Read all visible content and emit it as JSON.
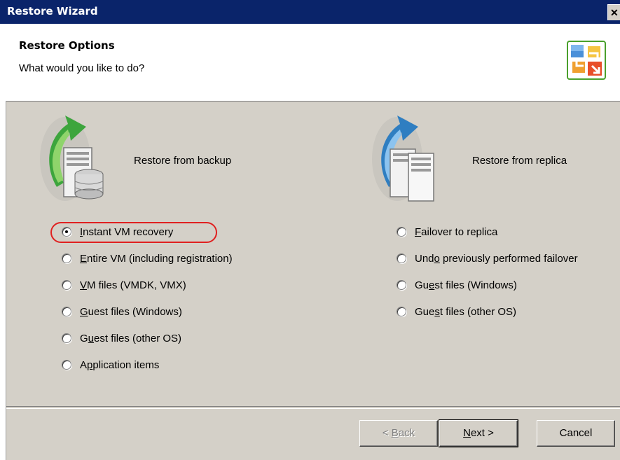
{
  "window": {
    "title": "Restore Wizard",
    "close_glyph": "✕"
  },
  "header": {
    "title": "Restore Options",
    "subtitle": "What would you like to do?",
    "icon": "restore-wizard-icon"
  },
  "backup_group": {
    "label": "Restore from backup",
    "icon": "backup-server-database-icon",
    "options": [
      {
        "pre": "",
        "u": "I",
        "post": "nstant VM recovery",
        "checked": true
      },
      {
        "pre": "",
        "u": "E",
        "post": "ntire VM (including registration)",
        "checked": false
      },
      {
        "pre": "",
        "u": "V",
        "post": "M files (VMDK, VMX)",
        "checked": false
      },
      {
        "pre": "",
        "u": "G",
        "post": "uest files (Windows)",
        "checked": false
      },
      {
        "pre": "G",
        "u": "u",
        "post": "est files (other OS)",
        "checked": false
      },
      {
        "pre": "A",
        "u": "p",
        "post": "plication items",
        "checked": false
      }
    ]
  },
  "replica_group": {
    "label": "Restore from replica",
    "icon": "replica-server-icon",
    "options": [
      {
        "pre": "",
        "u": "F",
        "post": "ailover to replica",
        "checked": false
      },
      {
        "pre": "Und",
        "u": "o",
        "post": " previously performed failover",
        "checked": false
      },
      {
        "pre": "Gu",
        "u": "e",
        "post": "st files (Windows)",
        "checked": false
      },
      {
        "pre": "Gue",
        "u": "s",
        "post": "t files (other OS)",
        "checked": false
      }
    ]
  },
  "buttons": {
    "back": {
      "pre": "< ",
      "u": "B",
      "post": "ack",
      "enabled": false
    },
    "next": {
      "pre": "",
      "u": "N",
      "post": "ext >",
      "enabled": true
    },
    "cancel": {
      "label": "Cancel",
      "enabled": true
    }
  },
  "colors": {
    "titlebar": "#0a246a",
    "dialog_bg": "#d4d0c8",
    "highlight": "#e02020"
  }
}
